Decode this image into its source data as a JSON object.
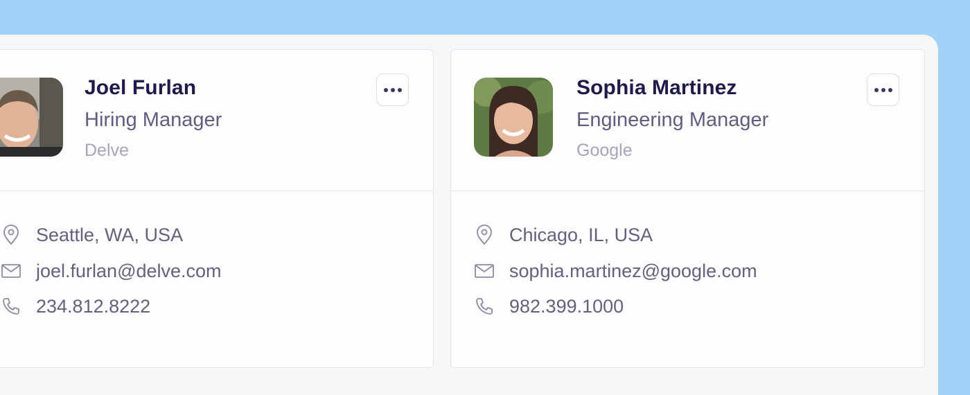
{
  "contacts": [
    {
      "name": "Joel Furlan",
      "title": "Hiring Manager",
      "company": "Delve",
      "location": "Seattle, WA, USA",
      "email": "joel.furlan@delve.com",
      "phone": "234.812.8222"
    },
    {
      "name": "Sophia Martinez",
      "title": "Engineering Manager",
      "company": "Google",
      "location": "Chicago, IL, USA",
      "email": "sophia.martinez@google.com",
      "phone": "982.399.1000"
    }
  ],
  "icons": {
    "more": "more-horizontal-icon",
    "location": "map-pin-icon",
    "email": "mail-icon",
    "phone": "phone-icon"
  },
  "colors": {
    "background": "#a3d2f8",
    "name": "#1e1a4b",
    "title": "#615d80",
    "company": "#a6a4bb"
  }
}
